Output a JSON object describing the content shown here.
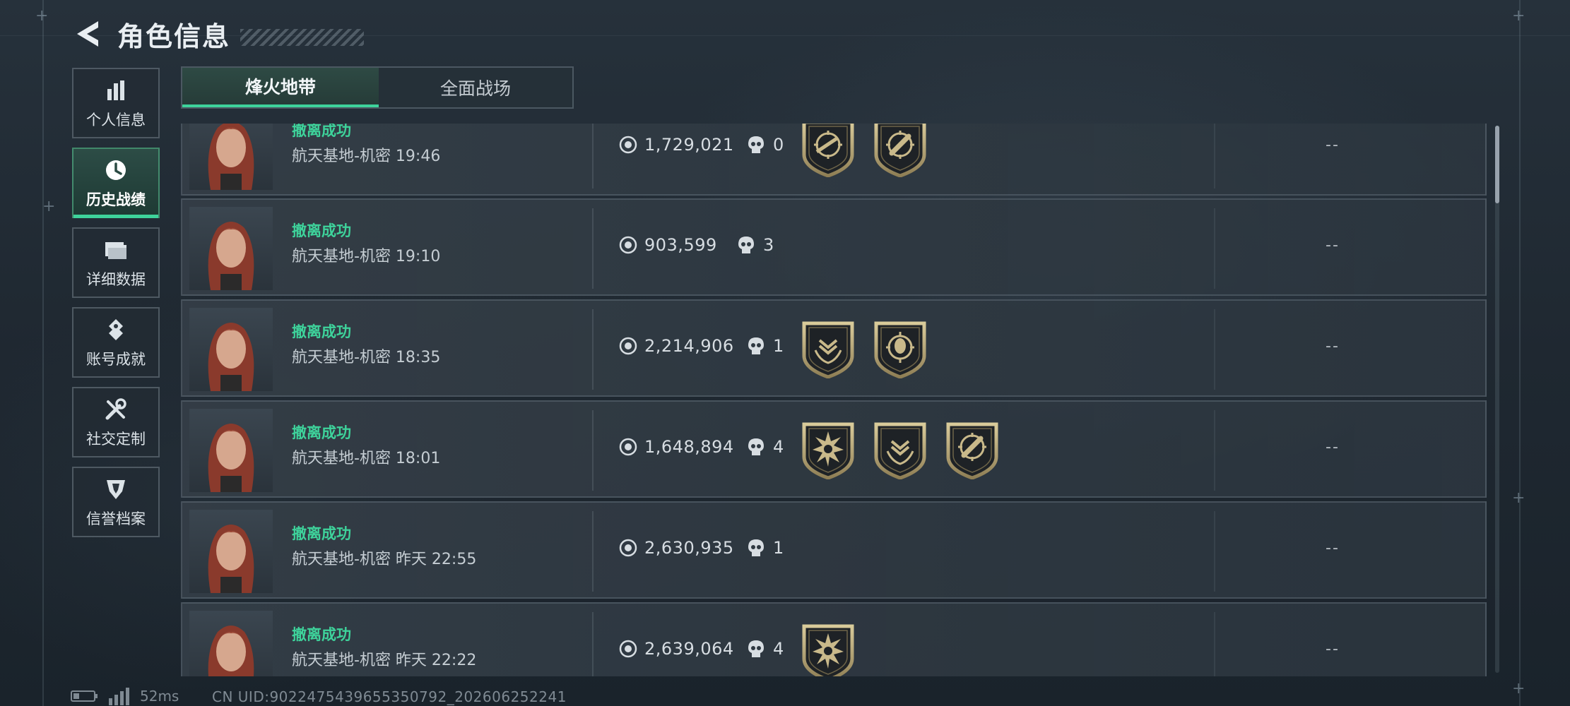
{
  "header": {
    "title": "角色信息",
    "back_icon": "back-arrow-icon"
  },
  "sidebar": {
    "items": [
      {
        "label": "个人信息",
        "icon": "bar-chart-icon",
        "active": false
      },
      {
        "label": "历史战绩",
        "icon": "clock-history-icon",
        "active": true
      },
      {
        "label": "详细数据",
        "icon": "folder-icon",
        "active": false
      },
      {
        "label": "账号成就",
        "icon": "medal-icon",
        "active": false
      },
      {
        "label": "社交定制",
        "icon": "tools-icon",
        "active": false
      },
      {
        "label": "信誉档案",
        "icon": "shield-icon",
        "active": false
      }
    ]
  },
  "tabs": [
    {
      "label": "烽火地带",
      "active": true
    },
    {
      "label": "全面战场",
      "active": false
    }
  ],
  "records": [
    {
      "status": "撤离成功",
      "detail": "航天基地-机密 19:46",
      "value": "1,729,021",
      "kills": "0",
      "badges": [
        "rifle-crosshair-badge",
        "rocket-crosshair-badge"
      ],
      "extra": "--"
    },
    {
      "status": "撤离成功",
      "detail": "航天基地-机密 19:10",
      "value": "903,599",
      "kills": "3",
      "badges": [],
      "extra": "--"
    },
    {
      "status": "撤离成功",
      "detail": "航天基地-机密 18:35",
      "value": "2,214,906",
      "kills": "1",
      "badges": [
        "chevron-laurel-badge",
        "soldier-target-badge"
      ],
      "extra": "--"
    },
    {
      "status": "撤离成功",
      "detail": "航天基地-机密 18:01",
      "value": "1,648,894",
      "kills": "4",
      "badges": [
        "skull-burst-badge",
        "chevron-laurel-badge",
        "rocket-crosshair-badge"
      ],
      "extra": "--"
    },
    {
      "status": "撤离成功",
      "detail": "航天基地-机密 昨天 22:55",
      "value": "2,630,935",
      "kills": "1",
      "badges": [],
      "extra": "--"
    },
    {
      "status": "撤离成功",
      "detail": "航天基地-机密 昨天 22:22",
      "value": "2,639,064",
      "kills": "4",
      "badges": [
        "skull-burst-badge"
      ],
      "extra": "--"
    }
  ],
  "footer": {
    "ping": "52ms",
    "uid": "CN UID:9022475439655350792_202606252241",
    "battery_icon": "battery-icon",
    "signal_icon": "signal-icon"
  },
  "colors": {
    "accent": "#3ed39b",
    "background": "#1e2730",
    "badge_gold": "#c9b98a"
  }
}
